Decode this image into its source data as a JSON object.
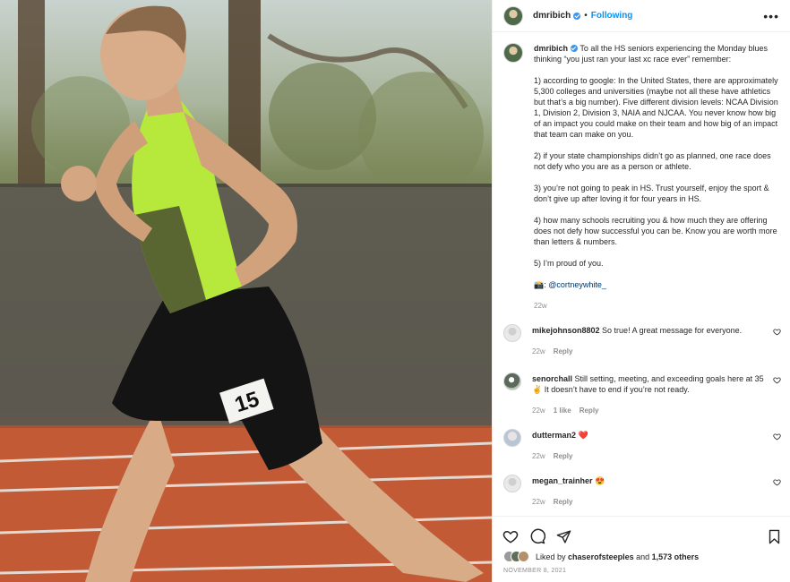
{
  "post": {
    "author": "dmribich",
    "follow_state": "Following",
    "separator": "•",
    "more_label": "•••",
    "verified": true
  },
  "caption": {
    "username": "dmribich",
    "intro": "To all the HS seniors experiencing the Monday blues thinking “you just ran your last xc race ever” remember:",
    "points": [
      "1) according to google: In the United States, there are approximately 5,300 colleges and universities (maybe not all these have athletics but that’s a big number). Five different division levels: NCAA Division 1, Division 2, Division 3, NAIA and NJCAA. You never know how big of an impact you could make on their team and how big of an impact that team can make on you.",
      "2) if your state championships didn’t go as planned, one race does not defy who you are as a person or athlete.",
      "3) you’re not going to peak in HS. Trust yourself, enjoy the sport & don’t give up after loving it for four years in HS.",
      "4) how many schools recruiting you & how much they are offering does not defy how successful you can be. Know you are worth more than letters & numbers.",
      "5) I’m proud of you."
    ],
    "credit_emoji": "📸",
    "credit_handle": "@cortneywhite_",
    "age": "22w"
  },
  "comments": [
    {
      "username": "mikejohnson8802",
      "text": "So true! A great message for everyone.",
      "age": "22w",
      "likes": "",
      "reply": "Reply"
    },
    {
      "username": "senorchall",
      "text": "Still setting, meeting, and exceeding goals here at 35✌️ It doesn’t have to end if you’re not ready.",
      "age": "22w",
      "likes": "1 like",
      "reply": "Reply"
    },
    {
      "username": "dutterman2",
      "text": "❤️",
      "age": "22w",
      "likes": "",
      "reply": "Reply"
    },
    {
      "username": "megan_trainher",
      "text": "😍",
      "age": "22w",
      "likes": "",
      "reply": "Reply"
    }
  ],
  "footer": {
    "liked_prefix": "Liked by",
    "liked_user": "chaserofsteeples",
    "liked_and": "and",
    "liked_others": "1,573 others",
    "date": "NOVEMBER 8, 2021"
  },
  "photo": {
    "bib_number": "15"
  },
  "colors": {
    "link_blue": "#0095f6",
    "text": "#262626",
    "muted": "#8e8e8e",
    "heart_red": "#ed4956",
    "singlet_green": "#b6e93c"
  }
}
